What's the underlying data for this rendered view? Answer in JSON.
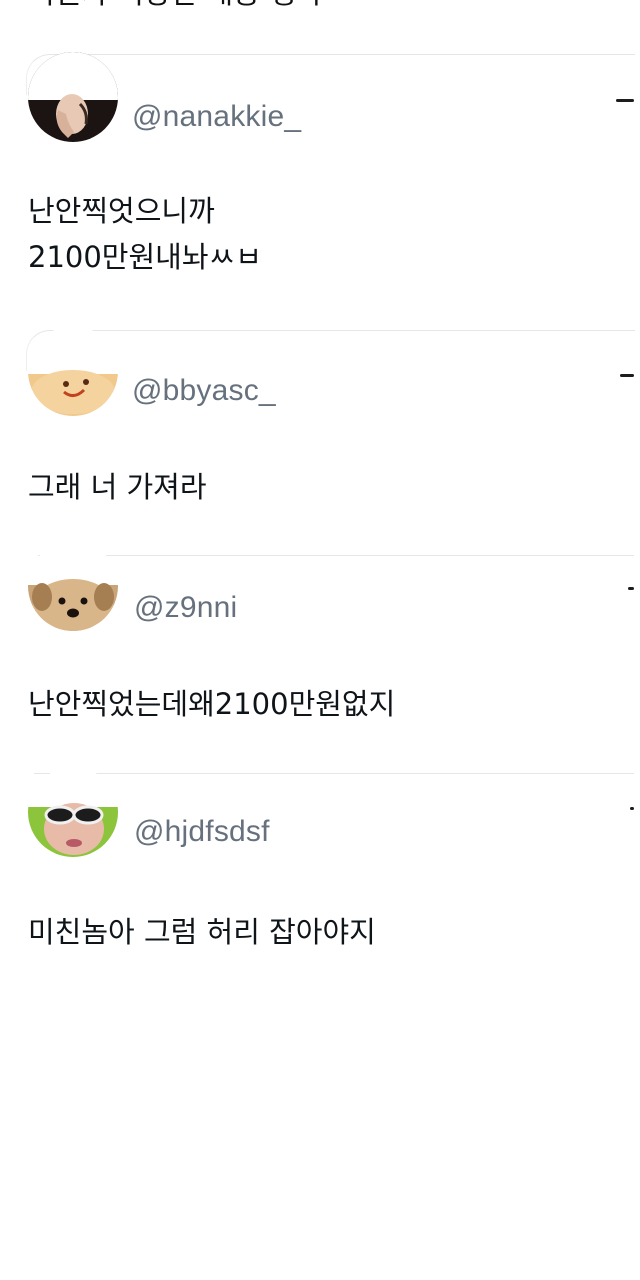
{
  "top_snippet": "어딘가 이상한 내용 생략",
  "tweets": [
    {
      "handle": "@nanakkie_",
      "avatar_icon": "avatar-hand-face",
      "lines": [
        "난안찍엇으니까",
        "2100만원내놔ㅆㅂ"
      ]
    },
    {
      "handle": "@bbyasc_",
      "avatar_icon": "avatar-cartoon-face",
      "lines": [
        "그래 너 가져라"
      ]
    },
    {
      "handle": "@z9nni",
      "avatar_icon": "avatar-dog",
      "lines": [
        "난안찍었는데왜2100만원없지"
      ]
    },
    {
      "handle": "@hjdfsdsf",
      "avatar_icon": "avatar-sunglasses",
      "lines": [
        "미친놈아 그럼 허리 잡아야지"
      ]
    }
  ],
  "colors": {
    "text": "#0f1419",
    "handle": "#66717d",
    "border": "#e4e6e9"
  }
}
